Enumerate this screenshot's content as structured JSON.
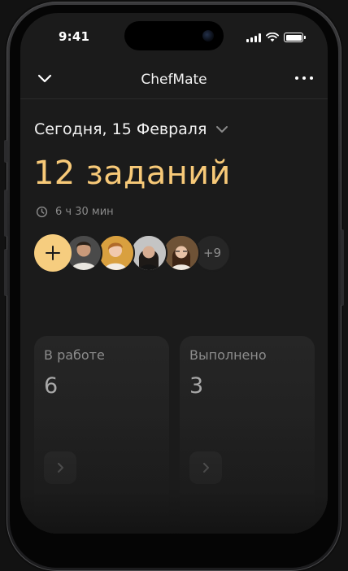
{
  "status_bar": {
    "time": "9:41"
  },
  "header": {
    "title": "ChefMate",
    "left_icon": "chevron-down-icon",
    "right_icon": "more-horizontal-icon"
  },
  "summary": {
    "date": "Сегодня, 15 Февраля",
    "tasks": "12 заданий",
    "duration": "6 ч 30 мин"
  },
  "team": {
    "add_icon": "plus-icon",
    "avatars": [
      {
        "name": "avatar-1"
      },
      {
        "name": "avatar-2"
      },
      {
        "name": "avatar-3"
      },
      {
        "name": "avatar-4"
      }
    ],
    "more_count": "+9"
  },
  "cards": [
    {
      "label": "В работе",
      "value": "6",
      "icon": "chevron-right-icon"
    },
    {
      "label": "Выполнено",
      "value": "3",
      "icon": "chevron-right-icon"
    }
  ],
  "colors": {
    "accent": "#F6CD7F",
    "background": "#1B1B1B",
    "card": "#262626"
  }
}
